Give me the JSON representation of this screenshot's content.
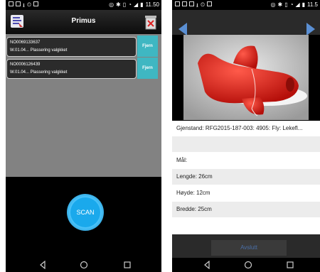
{
  "status_bar": {
    "time": "11.50",
    "time_right": "11.5"
  },
  "left": {
    "title": "Primus",
    "items": [
      {
        "id": "NO0069133637",
        "status": "W.01.04... Plassering valgkket",
        "action": "Fjern"
      },
      {
        "id": "NO0006126439",
        "status": "W.01.04... Plassering valgkket",
        "action": "Fjern"
      }
    ],
    "scan_label": "SCAN",
    "icons": {
      "app": "list-icon",
      "trash": "trash-icon"
    }
  },
  "right": {
    "object_line": "Gjenstand: RFG2015-187-003: 4905: Fly: Lekefl...",
    "mal_label": "Mål:",
    "lengde": "Lengde: 26cm",
    "hoyde": "Høyde: 12cm",
    "bredde": "Bredde: 25cm",
    "button_label": "Avslutt"
  },
  "colors": {
    "accent": "#3fb7c2",
    "scan": "#1aa9ec",
    "arrow": "#5a8fd3"
  }
}
